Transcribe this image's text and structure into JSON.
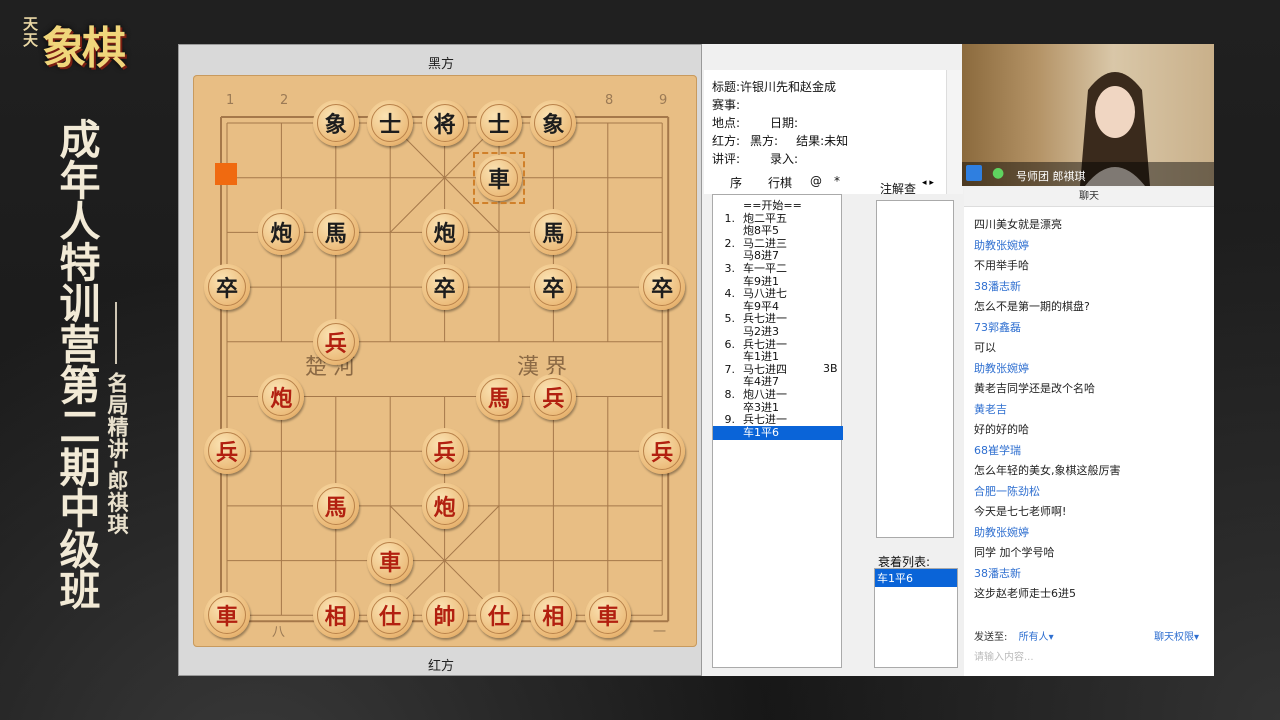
{
  "promo": {
    "logo_small": "天天",
    "logo_big": "象棋",
    "title": "成年人特训营第二期中级班",
    "subtitle": "名局精讲-郎祺琪"
  },
  "board": {
    "top_label": "黑方",
    "bottom_label": "红方",
    "top_coords": [
      "1",
      "2",
      "8",
      "9"
    ],
    "bottom_coords": [
      "八",
      "一"
    ],
    "river_left": "楚河",
    "river_right": "漢界",
    "pieces": [
      {
        "t": "象",
        "s": "b",
        "c": 2,
        "r": 0
      },
      {
        "t": "士",
        "s": "b",
        "c": 3,
        "r": 0
      },
      {
        "t": "将",
        "s": "b",
        "c": 4,
        "r": 0
      },
      {
        "t": "士",
        "s": "b",
        "c": 5,
        "r": 0
      },
      {
        "t": "象",
        "s": "b",
        "c": 6,
        "r": 0
      },
      {
        "t": "車",
        "s": "b",
        "c": 5,
        "r": 1
      },
      {
        "t": "炮",
        "s": "b",
        "c": 1,
        "r": 2
      },
      {
        "t": "馬",
        "s": "b",
        "c": 2,
        "r": 2
      },
      {
        "t": "炮",
        "s": "b",
        "c": 4,
        "r": 2
      },
      {
        "t": "馬",
        "s": "b",
        "c": 6,
        "r": 2
      },
      {
        "t": "卒",
        "s": "b",
        "c": 0,
        "r": 3
      },
      {
        "t": "卒",
        "s": "b",
        "c": 4,
        "r": 3
      },
      {
        "t": "卒",
        "s": "b",
        "c": 6,
        "r": 3
      },
      {
        "t": "卒",
        "s": "b",
        "c": 8,
        "r": 3
      },
      {
        "t": "兵",
        "s": "r",
        "c": 2,
        "r": 4
      },
      {
        "t": "炮",
        "s": "r",
        "c": 1,
        "r": 5
      },
      {
        "t": "馬",
        "s": "r",
        "c": 5,
        "r": 5
      },
      {
        "t": "兵",
        "s": "r",
        "c": 6,
        "r": 5
      },
      {
        "t": "兵",
        "s": "r",
        "c": 0,
        "r": 6
      },
      {
        "t": "兵",
        "s": "r",
        "c": 4,
        "r": 6
      },
      {
        "t": "兵",
        "s": "r",
        "c": 8,
        "r": 6
      },
      {
        "t": "馬",
        "s": "r",
        "c": 2,
        "r": 7
      },
      {
        "t": "炮",
        "s": "r",
        "c": 4,
        "r": 7
      },
      {
        "t": "車",
        "s": "r",
        "c": 3,
        "r": 8
      },
      {
        "t": "車",
        "s": "r",
        "c": 0,
        "r": 9
      },
      {
        "t": "相",
        "s": "r",
        "c": 2,
        "r": 9
      },
      {
        "t": "仕",
        "s": "r",
        "c": 3,
        "r": 9
      },
      {
        "t": "帥",
        "s": "r",
        "c": 4,
        "r": 9
      },
      {
        "t": "仕",
        "s": "r",
        "c": 5,
        "r": 9
      },
      {
        "t": "相",
        "s": "r",
        "c": 6,
        "r": 9
      },
      {
        "t": "車",
        "s": "r",
        "c": 7,
        "r": 9
      }
    ],
    "selected": {
      "c": 5,
      "r": 1
    },
    "marker_color": "#f06a10"
  },
  "info": {
    "title_label": "标题:",
    "title_value": "许银川先和赵金成",
    "event_label": "赛事:",
    "place_label": "地点:",
    "date_label": "日期:",
    "red_label": "红方:",
    "black_label": "黑方:",
    "result_label": "结果:",
    "result_value": "未知",
    "comment_label": "讲评:",
    "entry_label": "录入:"
  },
  "moves_header": {
    "seq": "序",
    "moves": "行棋",
    "at": "@",
    "star": "*"
  },
  "moves": [
    {
      "n": "",
      "t": "==开始=="
    },
    {
      "n": "1.",
      "t": "炮二平五"
    },
    {
      "n": "",
      "t": "炮8平5"
    },
    {
      "n": "2.",
      "t": "马二进三"
    },
    {
      "n": "",
      "t": "马8进7"
    },
    {
      "n": "3.",
      "t": "车一平二"
    },
    {
      "n": "",
      "t": "车9进1"
    },
    {
      "n": "4.",
      "t": "马八进七"
    },
    {
      "n": "",
      "t": "车9平4"
    },
    {
      "n": "5.",
      "t": "兵七进一"
    },
    {
      "n": "",
      "t": "马2进3"
    },
    {
      "n": "6.",
      "t": "兵七进一"
    },
    {
      "n": "",
      "t": "车1进1"
    },
    {
      "n": "7.",
      "t": "马七进四"
    },
    {
      "n": "",
      "t": "车4进7"
    },
    {
      "n": "8.",
      "t": "炮八进一"
    },
    {
      "n": "",
      "t": "卒3进1"
    },
    {
      "n": "9.",
      "t": "兵七进一"
    },
    {
      "n": "",
      "t": "车1平6"
    }
  ],
  "move_note": "3B",
  "notes_header": "注解查",
  "watch_header": "衰着列表:",
  "watch_item": "车1平6",
  "video": {
    "user": "号师团 郎祺琪"
  },
  "chat": {
    "title": "聊天",
    "messages": [
      {
        "kind": "text",
        "v": "四川美女就是漂亮"
      },
      {
        "kind": "name",
        "v": "助教张婉婷"
      },
      {
        "kind": "text",
        "v": "不用举手哈"
      },
      {
        "kind": "name",
        "v": "38潘志新"
      },
      {
        "kind": "text",
        "v": "怎么不是第一期的棋盘?"
      },
      {
        "kind": "name",
        "v": "73郭鑫磊"
      },
      {
        "kind": "text",
        "v": "可以"
      },
      {
        "kind": "name",
        "v": "助教张婉婷"
      },
      {
        "kind": "text",
        "v": "黄老吉同学还是改个名哈"
      },
      {
        "kind": "name",
        "v": "黄老吉"
      },
      {
        "kind": "text",
        "v": "好的好的哈"
      },
      {
        "kind": "name",
        "v": "68崔学瑞"
      },
      {
        "kind": "text",
        "v": "怎么年轻的美女,象棋这般厉害"
      },
      {
        "kind": "name",
        "v": "合肥一陈劲松"
      },
      {
        "kind": "text",
        "v": "今天是七七老师啊!"
      },
      {
        "kind": "name",
        "v": "助教张婉婷"
      },
      {
        "kind": "text",
        "v": "同学 加个学号哈"
      },
      {
        "kind": "name",
        "v": "38潘志新"
      },
      {
        "kind": "text",
        "v": "这步赵老师走士6进5"
      }
    ],
    "send_to_label": "发送至:",
    "send_to_value": "所有人",
    "perm": "聊天权限",
    "input_placeholder": "请输入内容..."
  }
}
